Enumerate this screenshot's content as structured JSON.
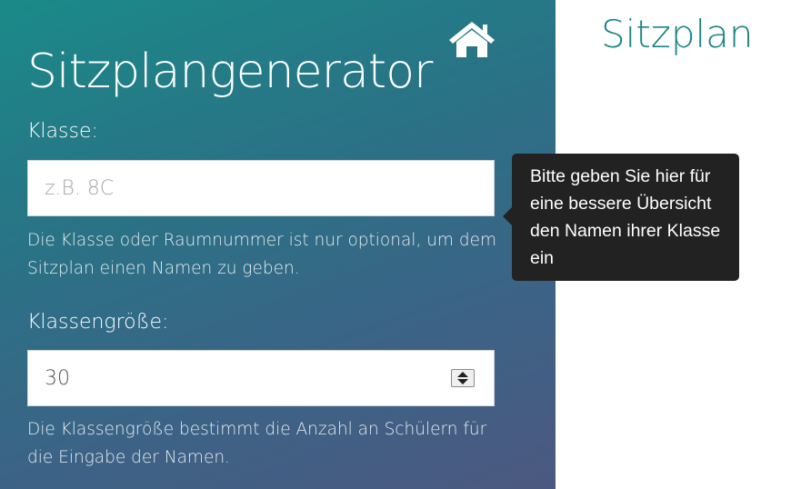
{
  "header": {
    "home_icon": "home-icon",
    "app_title": "Sitzplangenerator"
  },
  "right_panel": {
    "title": "Sitzplan"
  },
  "form": {
    "class_field": {
      "label": "Klasse:",
      "placeholder": "z.B. 8C",
      "value": "",
      "help": "Die Klasse oder Raumnummer ist nur optional, um dem Sitzplan einen Namen zu geben."
    },
    "size_field": {
      "label": "Klassengröße:",
      "value": "30",
      "help": "Die Klassengröße bestimmt die Anzahl an Schülern für die Eingabe der Namen."
    }
  },
  "tooltip": {
    "text": "Bitte geben Sie hier für eine bessere Übersicht den Namen ihrer Klasse ein"
  },
  "colors": {
    "panel_gradient_start": "#1a8a88",
    "panel_gradient_end": "#4c5880",
    "accent": "#1b8483",
    "tooltip_bg": "#222222"
  }
}
